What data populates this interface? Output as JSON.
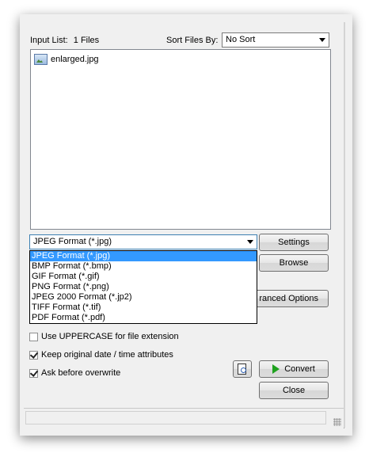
{
  "input_list": {
    "label": "Input List:",
    "count": "1 Files",
    "files": [
      {
        "name": "enlarged.jpg",
        "icon": "image-file-icon"
      }
    ]
  },
  "sort": {
    "label": "Sort Files By:",
    "selected": "No Sort"
  },
  "format": {
    "selected": "JPEG Format (*.jpg)",
    "options": [
      "JPEG Format (*.jpg)",
      "BMP Format (*.bmp)",
      "GIF Format (*.gif)",
      "PNG Format (*.png)",
      "JPEG 2000 Format (*.jp2)",
      "TIFF Format (*.tif)",
      "PDF Format (*.pdf)"
    ],
    "highlighted_index": 0
  },
  "buttons": {
    "settings": "Settings",
    "browse": "Browse",
    "advanced": "ranced Options",
    "convert": "Convert",
    "close": "Close"
  },
  "checkboxes": [
    {
      "label": "Use UPPERCASE for file extension",
      "checked": false
    },
    {
      "label": "Keep original date / time attributes",
      "checked": true
    },
    {
      "label": "Ask before overwrite",
      "checked": true
    }
  ],
  "colors": {
    "selection": "#3399ff",
    "convert_icon": "#1fa21f"
  }
}
